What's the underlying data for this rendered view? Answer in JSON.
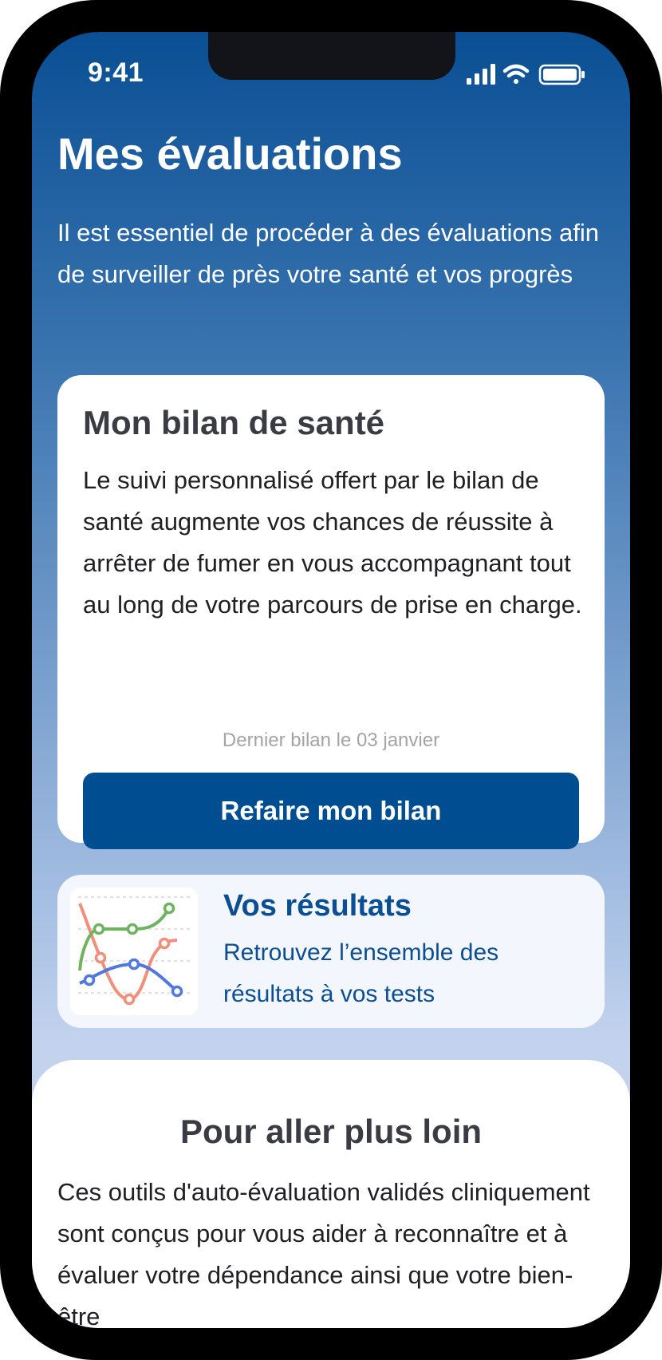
{
  "status_bar": {
    "time": "9:41",
    "icons": [
      "signal-icon",
      "wifi-icon",
      "battery-icon"
    ]
  },
  "header": {
    "title": "Mes évaluations",
    "intro": "Il est essentiel de procéder à des évaluations afin de surveiller de près votre santé et vos progrès"
  },
  "bilan_card": {
    "title": "Mon bilan de santé",
    "body": "Le suivi personnalisé offert par le bilan de santé augmente vos chances de réussite à arrêter de fumer en vous accompagnant tout au long de votre parcours de prise en charge.",
    "last_date": "Dernier bilan le 03 janvier",
    "button_label": "Refaire mon bilan"
  },
  "results_card": {
    "title": "Vos résultats",
    "subtitle": "Retrouvez l’ensemble des résultats à vos tests",
    "thumbnail_icon": "line-chart-icon"
  },
  "further_section": {
    "title": "Pour aller plus loin",
    "body": "Ces outils d'auto-évaluation validés cliniquement sont conçus pour vous aider à reconnaître et à évaluer votre dépendance ainsi que votre bien-être"
  },
  "colors": {
    "brand_blue": "#004e92",
    "gradient_top": "#0a4f94",
    "gradient_bottom": "#c3d3ee",
    "chart_green": "#6fb25f",
    "chart_orange": "#f0907a",
    "chart_blue": "#4f79e0"
  }
}
